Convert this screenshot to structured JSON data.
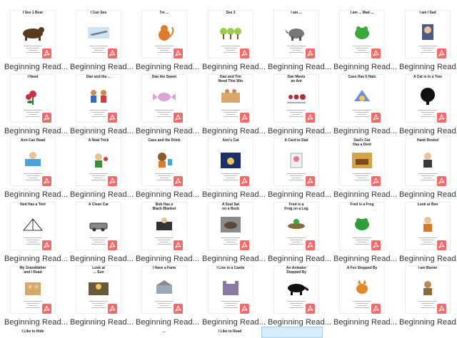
{
  "tile_label": "Beginning Read...",
  "files": [
    {
      "title": "I See 1 Bear",
      "art": "bear"
    },
    {
      "title": "I Can See",
      "art": "plane"
    },
    {
      "title": "I'm ...",
      "art": "cat"
    },
    {
      "title": "See 3",
      "art": "trees"
    },
    {
      "title": "I am ...",
      "art": "dino"
    },
    {
      "title": "I am ... Mad ...",
      "art": "frog"
    },
    {
      "title": "I am I Sad",
      "art": "boy"
    },
    {
      "title": "I Need",
      "art": "flower"
    },
    {
      "title": "Dan and the ...",
      "art": "kids"
    },
    {
      "title": "Dan the Sweet",
      "art": "candy"
    },
    {
      "title": "Dan and Tim\nNeed This Win",
      "art": "stand"
    },
    {
      "title": "Dan Meets\nan Ant",
      "art": "ant"
    },
    {
      "title": "Cass Has 5 Hats",
      "art": "hats"
    },
    {
      "title": "A Cat is in a Tree",
      "art": "tree"
    },
    {
      "title": "Ann Can Read",
      "art": "reader"
    },
    {
      "title": "A Neat Trick",
      "art": "trick"
    },
    {
      "title": "Cass and the Drink",
      "art": "drink"
    },
    {
      "title": "Ann's Cat",
      "art": "night"
    },
    {
      "title": "A Card to Dad",
      "art": "card"
    },
    {
      "title": "Dad's Car\nHas a Dent",
      "art": "car"
    },
    {
      "title": "Hank Rested",
      "art": "hank"
    },
    {
      "title": "Ned Has a Tent",
      "art": "tent"
    },
    {
      "title": "A Clean Car",
      "art": "wash"
    },
    {
      "title": "Bob Has a\nBlack Blanket",
      "art": "blanket"
    },
    {
      "title": "A Seal Sat\non a Rock",
      "art": "seal"
    },
    {
      "title": "Fred is a\nFrog on a Log",
      "art": "frog2"
    },
    {
      "title": "Fred is a Frog",
      "art": "frog3"
    },
    {
      "title": "Look at Ben",
      "art": "ben"
    },
    {
      "title": "My Grandfather\nand I Read",
      "art": "grand"
    },
    {
      "title": "Look at\n... Sun",
      "art": "sun"
    },
    {
      "title": "I Have a Farm",
      "art": "farm"
    },
    {
      "title": "I Live in a Castle",
      "art": "castle"
    },
    {
      "title": "An Anteater\nStopped By",
      "art": "anteater"
    },
    {
      "title": "A Fox Stopped By",
      "art": "fox"
    },
    {
      "title": "I am Baxter",
      "art": "baxter"
    }
  ],
  "partial_row": [
    {
      "title": "I Like to Hide"
    },
    {
      "title": "..."
    },
    {
      "title": "I Like to Read"
    },
    {
      "title": ""
    }
  ]
}
